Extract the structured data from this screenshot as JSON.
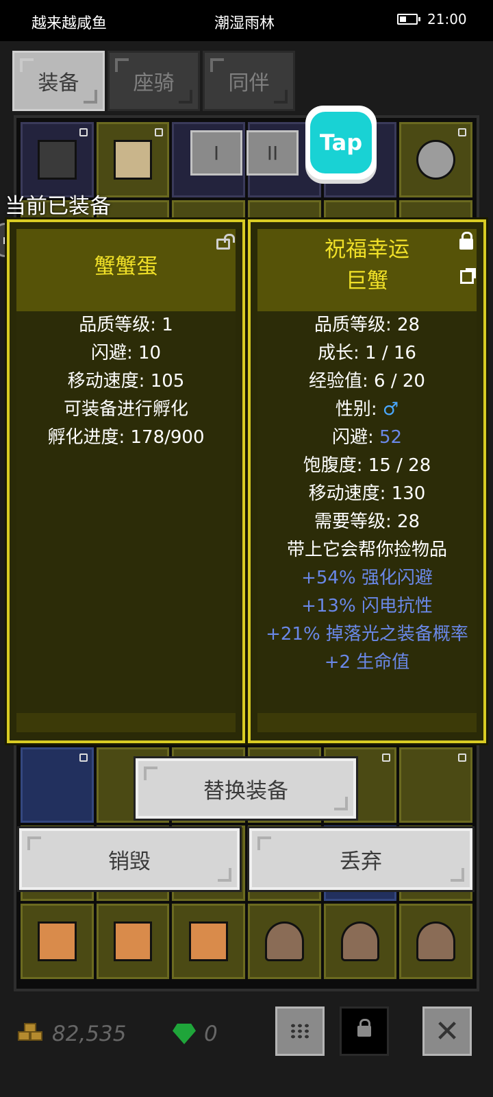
{
  "status_bar": {
    "left_text": "越来越咸鱼",
    "center_text": "潮湿雨林",
    "time": "21:00"
  },
  "tabs": [
    {
      "label": "装备",
      "active": true
    },
    {
      "label": "座骑",
      "active": false
    },
    {
      "label": "同伴",
      "active": false
    }
  ],
  "filter_buttons": [
    "I",
    "II"
  ],
  "equipped_label": "当前已装备",
  "current_item": {
    "name": "蟹蟹蛋",
    "lock_state": "unlocked",
    "stats": [
      "品质等级: 1",
      "闪避: 10",
      "移动速度: 105",
      "可装备进行孵化",
      "孵化进度: 178/900"
    ]
  },
  "compare_item": {
    "name_line1": "祝福幸运",
    "name_line2": "巨蟹",
    "lock_state": "locked",
    "stats": {
      "quality": "品质等级: 28",
      "growth": "成长: 1 / 16",
      "exp": "经验值: 6 / 20",
      "gender_label": "性别: ",
      "gender_symbol": "♂",
      "dodge_label": "闪避: ",
      "dodge_value": "52",
      "satiety": "饱腹度: 15 / 28",
      "move_speed": "移动速度: 130",
      "required_level": "需要等级: 28",
      "pickup": "带上它会帮你捡物品"
    },
    "bonuses": [
      "+54% 强化闪避",
      "+13% 闪电抗性",
      "+21% 掉落光之装备概率",
      "+2 生命值"
    ]
  },
  "actions": {
    "replace": "替换装备",
    "destroy": "销毁",
    "discard": "丢弃"
  },
  "currency": {
    "gold": "82,535",
    "gems": "0"
  },
  "colors": {
    "card_border": "#d9cc24",
    "title_yellow": "#f0e028",
    "bonus_blue": "#6a88e8",
    "tap_teal": "#19d2d4"
  },
  "icons": {
    "tap_logo": "Tap"
  }
}
